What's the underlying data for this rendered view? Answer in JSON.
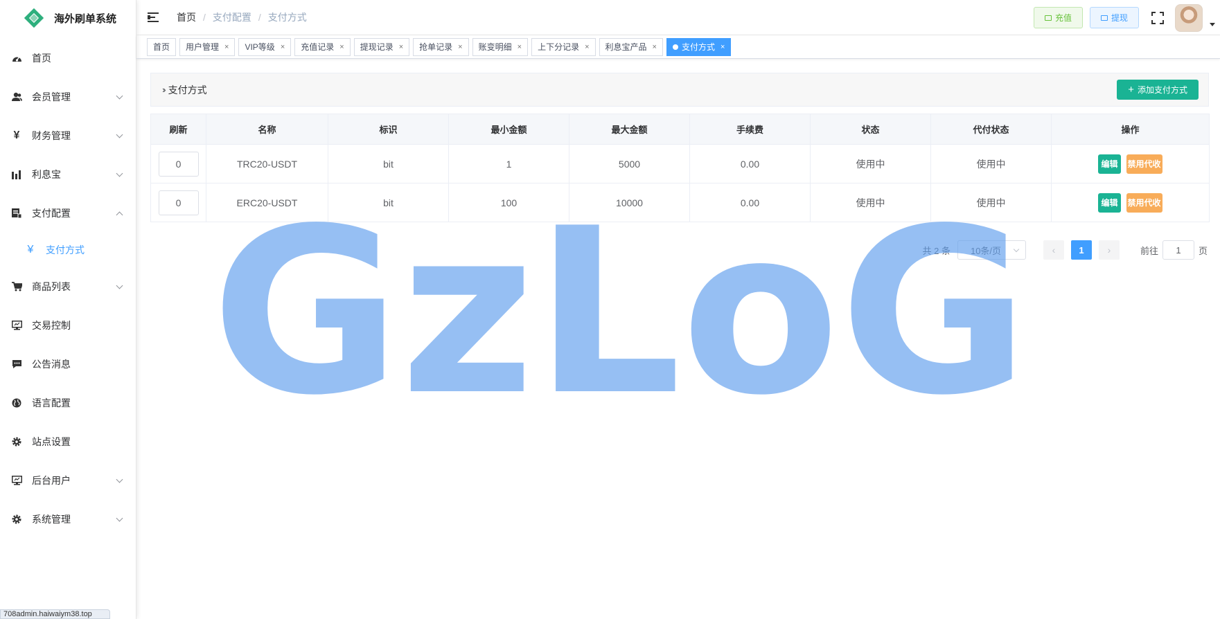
{
  "app": {
    "title": "海外刷单系统"
  },
  "sidebar": {
    "items": [
      {
        "label": "首页",
        "icon": "dashboard-icon"
      },
      {
        "label": "会员管理",
        "icon": "users-icon"
      },
      {
        "label": "财务管理",
        "icon": "yen-icon"
      },
      {
        "label": "利息宝",
        "icon": "bar-chart-icon"
      },
      {
        "label": "支付配置",
        "icon": "card-icon",
        "expanded": true
      },
      {
        "label": "商品列表",
        "icon": "cart-icon"
      },
      {
        "label": "交易控制",
        "icon": "monitor-icon"
      },
      {
        "label": "公告消息",
        "icon": "message-icon"
      },
      {
        "label": "语言配置",
        "icon": "globe-icon"
      },
      {
        "label": "站点设置",
        "icon": "gear-icon"
      },
      {
        "label": "后台用户",
        "icon": "monitor-icon"
      },
      {
        "label": "系统管理",
        "icon": "gear-icon"
      }
    ],
    "submenu": {
      "label": "支付方式",
      "icon": "yen-icon"
    }
  },
  "header": {
    "breadcrumb": [
      "首页",
      "支付配置",
      "支付方式"
    ],
    "recharge_label": "充值",
    "withdraw_label": "提现"
  },
  "tags": [
    "首页",
    "用户管理",
    "VIP等级",
    "充值记录",
    "提现记录",
    "抢单记录",
    "账变明细",
    "上下分记录",
    "利息宝产品",
    "支付方式"
  ],
  "tags_close": "×",
  "card": {
    "title": "支付方式",
    "add_label": "添加支付方式"
  },
  "table": {
    "headers": [
      "刷新",
      "名称",
      "标识",
      "最小金额",
      "最大金额",
      "手续费",
      "状态",
      "代付状态",
      "操作"
    ],
    "rows": [
      {
        "refresh": "0",
        "name": "TRC20-USDT",
        "code": "bit",
        "min": "1",
        "max": "5000",
        "fee": "0.00",
        "status": "使用中",
        "payout_status": "使用中"
      },
      {
        "refresh": "0",
        "name": "ERC20-USDT",
        "code": "bit",
        "min": "100",
        "max": "10000",
        "fee": "0.00",
        "status": "使用中",
        "payout_status": "使用中"
      }
    ],
    "edit_label": "编辑",
    "disable_label": "禁用代收"
  },
  "pager": {
    "total": "共 2 条",
    "page_size": "10条/页",
    "current": "1",
    "goto_label": "前往",
    "goto_value": "1",
    "page_suffix": "页"
  },
  "watermark": "GzLoG",
  "url_hint": "708admin.haiwaiym38.top",
  "colors": {
    "accent": "#409eff",
    "green": "#1ab394",
    "orange": "#f8ac59",
    "status": "#13ce66"
  }
}
